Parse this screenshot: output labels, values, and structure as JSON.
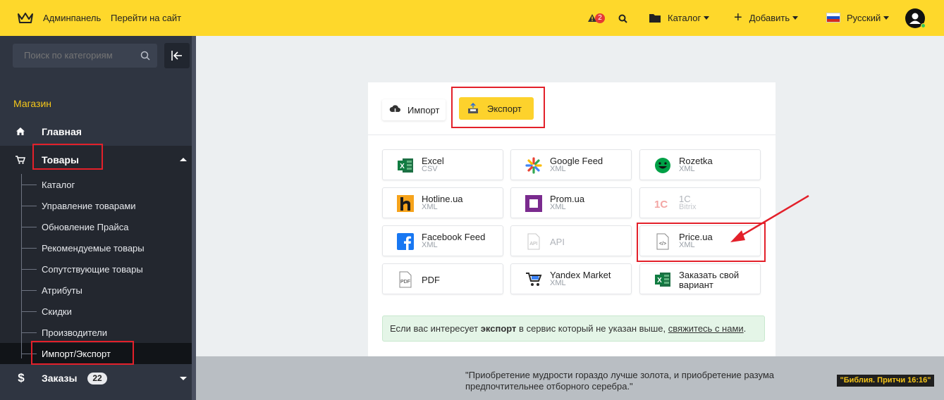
{
  "topbar": {
    "brand": "Админпанель",
    "site_link": "Перейти на сайт",
    "alerts_count": "2",
    "catalog_label": "Каталог",
    "add_label": "Добавить",
    "language_label": "Русский",
    "accent_color": "#fed82b"
  },
  "sidebar": {
    "search_placeholder": "Поиск по категориям",
    "section_title": "Магазин",
    "home_label": "Главная",
    "products_label": "Товары",
    "sub_items": [
      "Каталог",
      "Управление товарами",
      "Обновление Прайса",
      "Рекомендуемые товары",
      "Сопутствующие товары",
      "Атрибуты",
      "Скидки",
      "Производители",
      "Импорт/Экспорт"
    ],
    "orders_label": "Заказы",
    "orders_count": "22"
  },
  "main": {
    "tabs": {
      "import_label": "Импорт",
      "export_label": "Экспорт"
    },
    "tiles": [
      {
        "name": "Excel",
        "sub": "CSV",
        "icon": "excel-icon"
      },
      {
        "name": "Google Feed",
        "sub": "XML",
        "icon": "google-feed-icon"
      },
      {
        "name": "Rozetka",
        "sub": "XML",
        "icon": "rozetka-icon"
      },
      {
        "name": "Hotline.ua",
        "sub": "XML",
        "icon": "hotline-icon"
      },
      {
        "name": "Prom.ua",
        "sub": "XML",
        "icon": "prom-icon"
      },
      {
        "name": "1С",
        "sub": "Bitrix",
        "icon": "1c-icon"
      },
      {
        "name": "Facebook Feed",
        "sub": "XML",
        "icon": "facebook-icon"
      },
      {
        "name": "API",
        "icon": "api-file-icon"
      },
      {
        "name": "Price.ua",
        "sub": "XML",
        "icon": "code-file-icon"
      },
      {
        "name": "PDF",
        "icon": "pdf-file-icon"
      },
      {
        "name": "Yandex Market",
        "sub": "XML",
        "icon": "cart-icon"
      },
      {
        "name": "Заказать свой вариант",
        "icon": "excel-icon"
      }
    ],
    "notice": {
      "text_before": "Если вас интересует ",
      "bold": "экспорт",
      "text_middle": " в сервис который не указан выше, ",
      "link": "свяжитесь с нами",
      "text_after": "."
    }
  },
  "footer": {
    "quote_line1": "\"Приобретение мудрости гораздо лучше золота, и приобретение разума",
    "quote_line2": "предпочтительнее отборного серебра.\"",
    "source": "\"Библия. Притчи 16:16\""
  }
}
